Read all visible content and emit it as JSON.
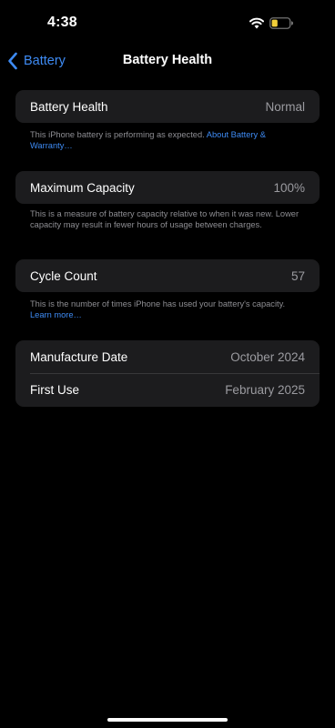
{
  "status_bar": {
    "time": "4:38",
    "battery_fill_color": "#f2cf3a",
    "icons": [
      "wifi-icon",
      "battery-icon"
    ]
  },
  "nav": {
    "back_label": "Battery",
    "title": "Battery Health"
  },
  "battery_health": {
    "label": "Battery Health",
    "value": "Normal",
    "note": "This iPhone battery is performing as expected.",
    "link": "About Battery & Warranty…"
  },
  "maximum_capacity": {
    "label": "Maximum Capacity",
    "value": "100%",
    "note": "This is a measure of battery capacity relative to when it was new. Lower capacity may result in fewer hours of usage between charges."
  },
  "cycle_count": {
    "label": "Cycle Count",
    "value": "57",
    "note": "This is the number of times iPhone has used your battery's capacity.",
    "link": "Learn more…"
  },
  "dates": {
    "manufacture_label": "Manufacture Date",
    "manufacture_value": "October 2024",
    "first_use_label": "First Use",
    "first_use_value": "February 2025"
  },
  "colors": {
    "accent": "#3e8bf4",
    "card_background": "#1c1c1e",
    "secondary_text": "#8e8e93"
  }
}
